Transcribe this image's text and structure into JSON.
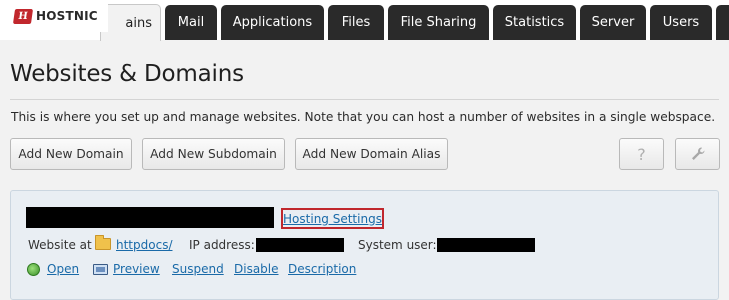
{
  "logo": {
    "mark": "H",
    "text": "HOSTNIC"
  },
  "tabs": [
    {
      "label": "ains",
      "active": true
    },
    {
      "label": "Mail"
    },
    {
      "label": "Applications"
    },
    {
      "label": "Files"
    },
    {
      "label": "File Sharing"
    },
    {
      "label": "Statistics"
    },
    {
      "label": "Server"
    },
    {
      "label": "Users"
    }
  ],
  "page": {
    "title": "Websites & Domains",
    "description": "This is where you set up and manage websites. Note that you can host a number of websites in a single webspace."
  },
  "toolbar": {
    "add_domain": "Add New Domain",
    "add_subdomain": "Add New Subdomain",
    "add_alias": "Add New Domain Alias",
    "help_icon": "?",
    "settings_icon": "wrench-icon"
  },
  "site": {
    "hosting_settings": "Hosting Settings",
    "website_at_label": "Website at",
    "docroot": "httpdocs/",
    "ip_label": "IP address:",
    "system_user_label": "System user:",
    "actions": {
      "open": "Open",
      "preview": "Preview",
      "suspend": "Suspend",
      "disable": "Disable",
      "description": "Description"
    }
  },
  "colors": {
    "tab_bg": "#2a2a2a",
    "link": "#1a6aa8",
    "highlight": "#c0272d",
    "panel_bg": "#e9eef3"
  }
}
